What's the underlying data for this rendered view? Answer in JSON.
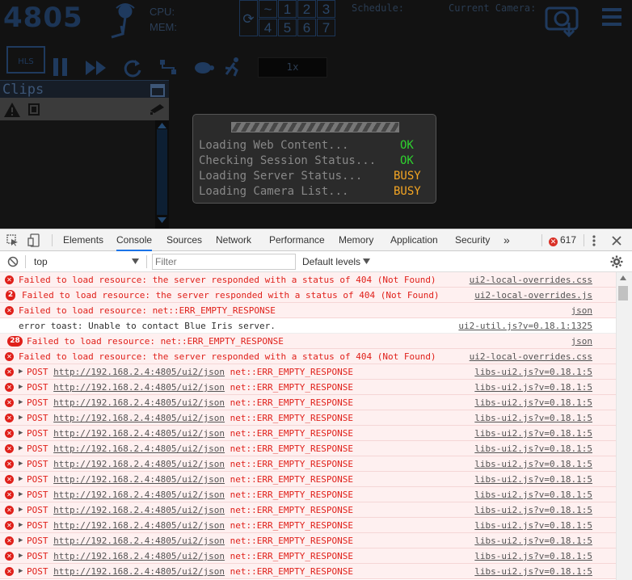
{
  "app": {
    "port": "4805",
    "cpu_label": "CPU:",
    "mem_label": "MEM:",
    "num_buttons": [
      "1",
      "2",
      "3",
      "4",
      "5",
      "6",
      "7"
    ],
    "schedule_label": "Schedule:",
    "current_camera_label": "Current Camera:",
    "speed": "1x",
    "clips_title": "Clips",
    "icons": [
      "antenna-icon",
      "refresh-icon",
      "reset-icon",
      "camera-download-icon",
      "menu-icon",
      "hls-film-icon",
      "pause-icon",
      "fast-forward-icon",
      "cycle-icon",
      "topology-icon",
      "turtle-icon",
      "runner-icon",
      "calendar-icon",
      "warning-icon",
      "film-icon",
      "camera-icon"
    ]
  },
  "loading": {
    "rows": [
      {
        "label": "Loading Web Content...",
        "status": "OK"
      },
      {
        "label": "Checking Session Status...",
        "status": "OK"
      },
      {
        "label": "Loading Server Status...",
        "status": "BUSY"
      },
      {
        "label": "Loading Camera List...",
        "status": "BUSY"
      }
    ]
  },
  "devtools": {
    "tabs": [
      "Elements",
      "Console",
      "Sources",
      "Network",
      "Performance",
      "Memory",
      "Application",
      "Security"
    ],
    "active_tab": "Console",
    "more": "»",
    "error_count": "617",
    "context": "top",
    "filter_placeholder": "Filter",
    "levels": "Default levels",
    "colors": {
      "error": "#e0201a",
      "error_bg": "#fef0f0",
      "accent": "#1a73e8"
    }
  },
  "console": [
    {
      "type": "err",
      "msg": "Failed to load resource: the server responded with a status of 404 (Not Found)",
      "src": "ui2-local-overrides.css"
    },
    {
      "type": "err",
      "count": "2",
      "msg": "Failed to load resource: the server responded with a status of 404 (Not Found)",
      "src": "ui2-local-overrides.js"
    },
    {
      "type": "err",
      "msg": "Failed to load resource: net::ERR_EMPTY_RESPONSE",
      "src": "json"
    },
    {
      "type": "info",
      "msg": "error toast: Unable to contact Blue Iris server.",
      "src": "ui2-util.js?v=0.18.1:1325"
    },
    {
      "type": "err",
      "count": "28",
      "msg": "Failed to load resource: net::ERR_EMPTY_RESPONSE",
      "src": "json"
    },
    {
      "type": "err",
      "msg": "Failed to load resource: the server responded with a status of 404 (Not Found)",
      "src": "ui2-local-overrides.css"
    },
    {
      "type": "post",
      "method": "POST",
      "url": "http://192.168.2.4:4805/ui2/json",
      "err": "net::ERR_EMPTY_RESPONSE",
      "src": "libs-ui2.js?v=0.18.1:5"
    },
    {
      "type": "post",
      "method": "POST",
      "url": "http://192.168.2.4:4805/ui2/json",
      "err": "net::ERR_EMPTY_RESPONSE",
      "src": "libs-ui2.js?v=0.18.1:5"
    },
    {
      "type": "post",
      "method": "POST",
      "url": "http://192.168.2.4:4805/ui2/json",
      "err": "net::ERR_EMPTY_RESPONSE",
      "src": "libs-ui2.js?v=0.18.1:5"
    },
    {
      "type": "post",
      "method": "POST",
      "url": "http://192.168.2.4:4805/ui2/json",
      "err": "net::ERR_EMPTY_RESPONSE",
      "src": "libs-ui2.js?v=0.18.1:5"
    },
    {
      "type": "post",
      "method": "POST",
      "url": "http://192.168.2.4:4805/ui2/json",
      "err": "net::ERR_EMPTY_RESPONSE",
      "src": "libs-ui2.js?v=0.18.1:5"
    },
    {
      "type": "post",
      "method": "POST",
      "url": "http://192.168.2.4:4805/ui2/json",
      "err": "net::ERR_EMPTY_RESPONSE",
      "src": "libs-ui2.js?v=0.18.1:5"
    },
    {
      "type": "post",
      "method": "POST",
      "url": "http://192.168.2.4:4805/ui2/json",
      "err": "net::ERR_EMPTY_RESPONSE",
      "src": "libs-ui2.js?v=0.18.1:5"
    },
    {
      "type": "post",
      "method": "POST",
      "url": "http://192.168.2.4:4805/ui2/json",
      "err": "net::ERR_EMPTY_RESPONSE",
      "src": "libs-ui2.js?v=0.18.1:5"
    },
    {
      "type": "post",
      "method": "POST",
      "url": "http://192.168.2.4:4805/ui2/json",
      "err": "net::ERR_EMPTY_RESPONSE",
      "src": "libs-ui2.js?v=0.18.1:5"
    },
    {
      "type": "post",
      "method": "POST",
      "url": "http://192.168.2.4:4805/ui2/json",
      "err": "net::ERR_EMPTY_RESPONSE",
      "src": "libs-ui2.js?v=0.18.1:5"
    },
    {
      "type": "post",
      "method": "POST",
      "url": "http://192.168.2.4:4805/ui2/json",
      "err": "net::ERR_EMPTY_RESPONSE",
      "src": "libs-ui2.js?v=0.18.1:5"
    },
    {
      "type": "post",
      "method": "POST",
      "url": "http://192.168.2.4:4805/ui2/json",
      "err": "net::ERR_EMPTY_RESPONSE",
      "src": "libs-ui2.js?v=0.18.1:5"
    },
    {
      "type": "post",
      "method": "POST",
      "url": "http://192.168.2.4:4805/ui2/json",
      "err": "net::ERR_EMPTY_RESPONSE",
      "src": "libs-ui2.js?v=0.18.1:5"
    },
    {
      "type": "post",
      "method": "POST",
      "url": "http://192.168.2.4:4805/ui2/json",
      "err": "net::ERR_EMPTY_RESPONSE",
      "src": "libs-ui2.js?v=0.18.1:5"
    }
  ]
}
